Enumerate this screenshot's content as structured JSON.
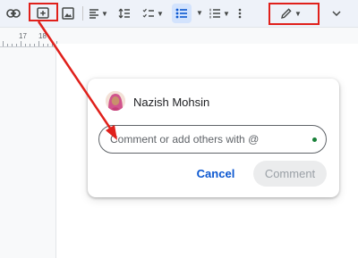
{
  "toolbar": {
    "items": [
      {
        "name": "insert-link-icon"
      },
      {
        "name": "add-comment-icon"
      },
      {
        "name": "insert-image-icon"
      },
      {
        "name": "align-icon"
      },
      {
        "name": "line-spacing-icon"
      },
      {
        "name": "checklist-icon"
      },
      {
        "name": "bulleted-list-icon"
      },
      {
        "name": "numbered-list-icon"
      },
      {
        "name": "more-vert-icon"
      },
      {
        "name": "editing-mode-pencil-icon"
      },
      {
        "name": "collapse-chevron-icon"
      }
    ]
  },
  "ruler": {
    "labels": [
      "17",
      "18"
    ]
  },
  "comment_card": {
    "user_name": "Nazish Mohsin",
    "input_placeholder": "Comment or add others with @",
    "input_value": "",
    "cancel_label": "Cancel",
    "comment_label": "Comment"
  },
  "colors": {
    "highlight_box": "#e0201b",
    "accent_blue": "#0b57d0",
    "status_dot": "#188038"
  }
}
